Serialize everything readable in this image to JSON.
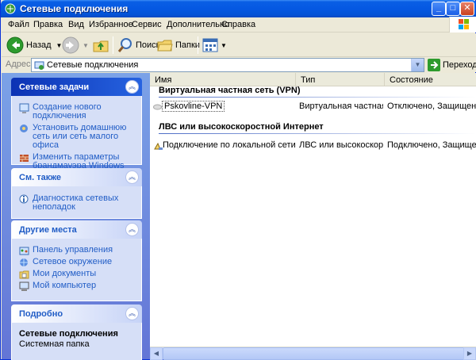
{
  "window": {
    "title": "Сетевые подключения",
    "buttons": {
      "minimize": "_",
      "maximize": "□",
      "close": "✕"
    }
  },
  "menu": {
    "items": [
      "Файл",
      "Правка",
      "Вид",
      "Избранное",
      "Сервис",
      "Дополнительно",
      "Справка"
    ]
  },
  "toolbar": {
    "back_label": "Назад",
    "search_label": "Поиск",
    "folders_label": "Папки"
  },
  "address": {
    "label": "Адрес:",
    "value": "Сетевые подключения",
    "go_label": "Переход"
  },
  "taskpane": {
    "network_tasks": {
      "title": "Сетевые задачи",
      "items": [
        "Создание нового подключения",
        "Установить домашнюю сеть или сеть малого офиса",
        "Изменить параметры брандмауэра Windows"
      ]
    },
    "see_also": {
      "title": "См. также",
      "items": [
        "Диагностика сетевых неполадок"
      ]
    },
    "other_places": {
      "title": "Другие места",
      "items": [
        "Панель управления",
        "Сетевое окружение",
        "Мои документы",
        "Мой компьютер"
      ]
    },
    "details": {
      "title": "Подробно",
      "name": "Сетевые подключения",
      "type": "Системная папка"
    }
  },
  "list": {
    "columns": [
      "Имя",
      "Тип",
      "Состояние"
    ],
    "groups": [
      {
        "title": "Виртуальная частная сеть (VPN)",
        "rows": [
          {
            "name": "Pskovline-VPN",
            "type": "Виртуальная частная с...",
            "status": "Отключено, Защищено..."
          }
        ]
      },
      {
        "title": "ЛВС или высокоскоростной Интернет",
        "rows": [
          {
            "name": "Подключение по локальной сети",
            "type": "ЛВС или высокоскорос...",
            "status": "Подключено, Защищен..."
          }
        ]
      }
    ]
  }
}
